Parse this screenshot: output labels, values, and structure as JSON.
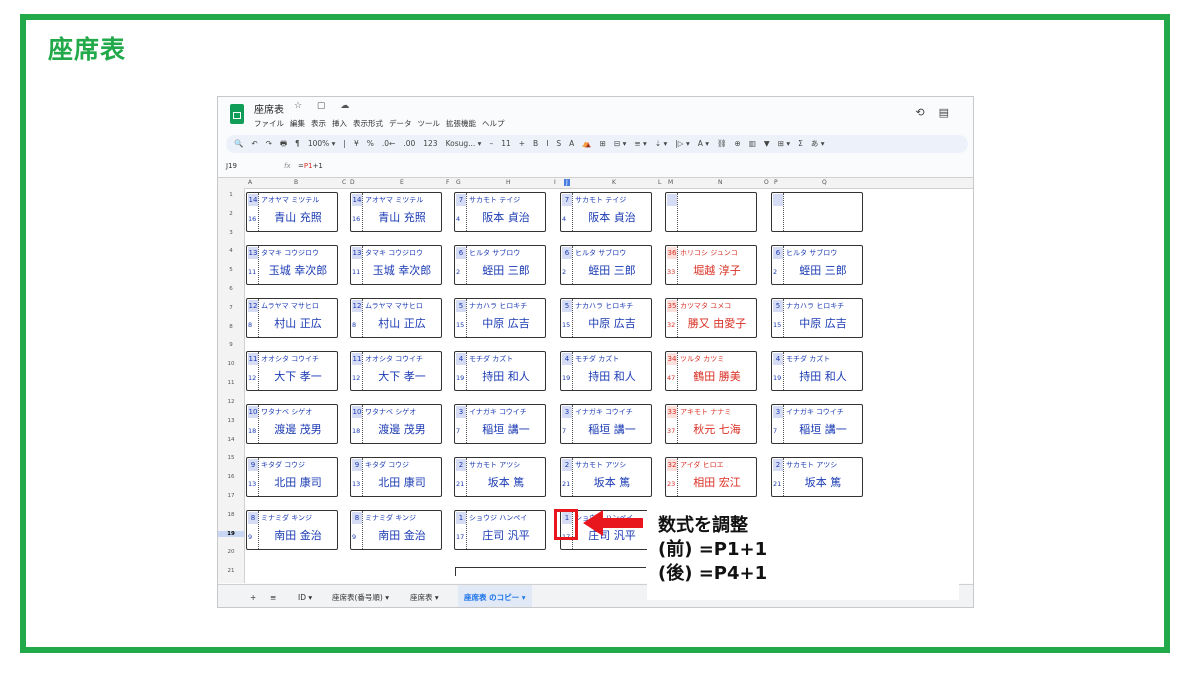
{
  "slide": {
    "title": "座席表"
  },
  "app": {
    "doc_title": "座席表",
    "title_icons": "☆ ▢ ☁",
    "menus": [
      "ファイル",
      "編集",
      "表示",
      "挿入",
      "表示形式",
      "データ",
      "ツール",
      "拡張機能",
      "ヘルプ"
    ],
    "toolbar": [
      "🔍",
      "↶",
      "↷",
      "🖶",
      "¶",
      "100% ▾",
      "|",
      "¥",
      "%",
      ".0←",
      ".00",
      "123",
      "Kosug... ▾",
      "–",
      "11",
      "+",
      "B",
      "I",
      "S",
      "A",
      "⛺",
      "⊞",
      "⊟ ▾",
      "≡ ▾",
      "⇣ ▾",
      "|▷ ▾",
      "A ▾",
      "⛓",
      "⊕",
      "▥",
      "▼",
      "⊞ ▾",
      "Σ",
      "あ ▾"
    ],
    "history_icon": "⟲",
    "comment_icon": "▤"
  },
  "formula_bar": {
    "cell_ref": "J19",
    "fx": "fx",
    "formula_prefix": "=",
    "formula_ref": "P1",
    "formula_suffix": "+1"
  },
  "columns": [
    "A",
    "B",
    "C",
    "D",
    "E",
    "F",
    "G",
    "H",
    "I",
    "J",
    "K",
    "L",
    "M",
    "N",
    "O",
    "P",
    "Q"
  ],
  "selected_column": "J",
  "rows": [
    "1",
    "2",
    "3",
    "4",
    "5",
    "6",
    "7",
    "8",
    "9",
    "10",
    "11",
    "12",
    "13",
    "14",
    "15",
    "16",
    "17",
    "18",
    "19",
    "20",
    "21"
  ],
  "selected_row": "19",
  "seats": [
    [
      {
        "n1": "14",
        "n2": "16",
        "kana": "アオヤマ ミツテル",
        "kanji": "青山 充照"
      },
      {
        "n1": "14",
        "n2": "16",
        "kana": "アオヤマ ミツテル",
        "kanji": "青山 充照"
      },
      {
        "n1": "7",
        "n2": "4",
        "kana": "サカモト テイジ",
        "kanji": "阪本 貞治"
      },
      {
        "n1": "7",
        "n2": "4",
        "kana": "サカモト テイジ",
        "kanji": "阪本 貞治"
      },
      {
        "n1": "",
        "n2": "",
        "kana": "",
        "kanji": ""
      },
      {
        "n1": "",
        "n2": "",
        "kana": "",
        "kanji": ""
      }
    ],
    [
      {
        "n1": "13",
        "n2": "11",
        "kana": "タマキ コウジロウ",
        "kanji": "玉城 幸次郎"
      },
      {
        "n1": "13",
        "n2": "11",
        "kana": "タマキ コウジロウ",
        "kanji": "玉城 幸次郎"
      },
      {
        "n1": "6",
        "n2": "2",
        "kana": "ヒルタ サブロウ",
        "kanji": "蛭田 三郎"
      },
      {
        "n1": "6",
        "n2": "2",
        "kana": "ヒルタ サブロウ",
        "kanji": "蛭田 三郎"
      },
      {
        "n1": "36",
        "n2": "33",
        "kana": "ホリコシ ジュンコ",
        "kanji": "堀越 淳子",
        "red": true
      },
      {
        "n1": "6",
        "n2": "2",
        "kana": "ヒルタ サブロウ",
        "kanji": "蛭田 三郎"
      }
    ],
    [
      {
        "n1": "12",
        "n2": "8",
        "kana": "ムラヤマ マサヒロ",
        "kanji": "村山 正広"
      },
      {
        "n1": "12",
        "n2": "8",
        "kana": "ムラヤマ マサヒロ",
        "kanji": "村山 正広"
      },
      {
        "n1": "5",
        "n2": "15",
        "kana": "ナカハラ ヒロキチ",
        "kanji": "中原 広吉"
      },
      {
        "n1": "5",
        "n2": "15",
        "kana": "ナカハラ ヒロキチ",
        "kanji": "中原 広吉"
      },
      {
        "n1": "35",
        "n2": "32",
        "kana": "カツマタ ユメコ",
        "kanji": "勝又 由愛子",
        "red": true
      },
      {
        "n1": "5",
        "n2": "15",
        "kana": "ナカハラ ヒロキチ",
        "kanji": "中原 広吉"
      }
    ],
    [
      {
        "n1": "11",
        "n2": "12",
        "kana": "オオシタ コウイチ",
        "kanji": "大下 孝一"
      },
      {
        "n1": "11",
        "n2": "12",
        "kana": "オオシタ コウイチ",
        "kanji": "大下 孝一"
      },
      {
        "n1": "4",
        "n2": "19",
        "kana": "モチダ カズト",
        "kanji": "持田 和人"
      },
      {
        "n1": "4",
        "n2": "19",
        "kana": "モチダ カズト",
        "kanji": "持田 和人"
      },
      {
        "n1": "34",
        "n2": "47",
        "kana": "ツルタ カツミ",
        "kanji": "鶴田 勝美",
        "red": true
      },
      {
        "n1": "4",
        "n2": "19",
        "kana": "モチダ カズト",
        "kanji": "持田 和人"
      }
    ],
    [
      {
        "n1": "10",
        "n2": "18",
        "kana": "ワタナベ シゲオ",
        "kanji": "渡邊 茂男"
      },
      {
        "n1": "10",
        "n2": "18",
        "kana": "ワタナベ シゲオ",
        "kanji": "渡邊 茂男"
      },
      {
        "n1": "3",
        "n2": "7",
        "kana": "イナガキ コウイチ",
        "kanji": "稲垣 講一"
      },
      {
        "n1": "3",
        "n2": "7",
        "kana": "イナガキ コウイチ",
        "kanji": "稲垣 講一"
      },
      {
        "n1": "33",
        "n2": "37",
        "kana": "アキモト ナナミ",
        "kanji": "秋元 七海",
        "red": true
      },
      {
        "n1": "3",
        "n2": "7",
        "kana": "イナガキ コウイチ",
        "kanji": "稲垣 講一"
      }
    ],
    [
      {
        "n1": "9",
        "n2": "13",
        "kana": "キタダ コウジ",
        "kanji": "北田 康司"
      },
      {
        "n1": "9",
        "n2": "13",
        "kana": "キタダ コウジ",
        "kanji": "北田 康司"
      },
      {
        "n1": "2",
        "n2": "21",
        "kana": "サカモト アツシ",
        "kanji": "坂本 篤"
      },
      {
        "n1": "2",
        "n2": "21",
        "kana": "サカモト アツシ",
        "kanji": "坂本 篤"
      },
      {
        "n1": "32",
        "n2": "23",
        "kana": "アイダ ヒロエ",
        "kanji": "相田 宏江",
        "red": true
      },
      {
        "n1": "2",
        "n2": "21",
        "kana": "サカモト アツシ",
        "kanji": "坂本 篤"
      }
    ],
    [
      {
        "n1": "8",
        "n2": "9",
        "kana": "ミナミダ キンジ",
        "kanji": "南田 金治"
      },
      {
        "n1": "8",
        "n2": "9",
        "kana": "ミナミダ キンジ",
        "kanji": "南田 金治"
      },
      {
        "n1": "1",
        "n2": "17",
        "kana": "ショウジ ハンペイ",
        "kanji": "庄司 汎平"
      },
      {
        "n1": "1",
        "n2": "17",
        "kana": "ショウジ ハンペイ",
        "kanji": "庄司 汎平"
      }
    ]
  ],
  "tabs": {
    "add": "+",
    "list": "≡",
    "items": [
      "ID ▾",
      "座席表(番号順) ▾",
      "座席表 ▾",
      "座席表 のコピー ▾"
    ],
    "active_index": 3
  },
  "callout": {
    "line1": "数式を調整",
    "line2": "(前) =P1+1",
    "line3": "(後) =P4+1"
  },
  "colors": {
    "frame": "#22a94a",
    "accent_red": "#e8171e",
    "name_blue": "#1a3ab3",
    "name_red": "#d93025"
  }
}
